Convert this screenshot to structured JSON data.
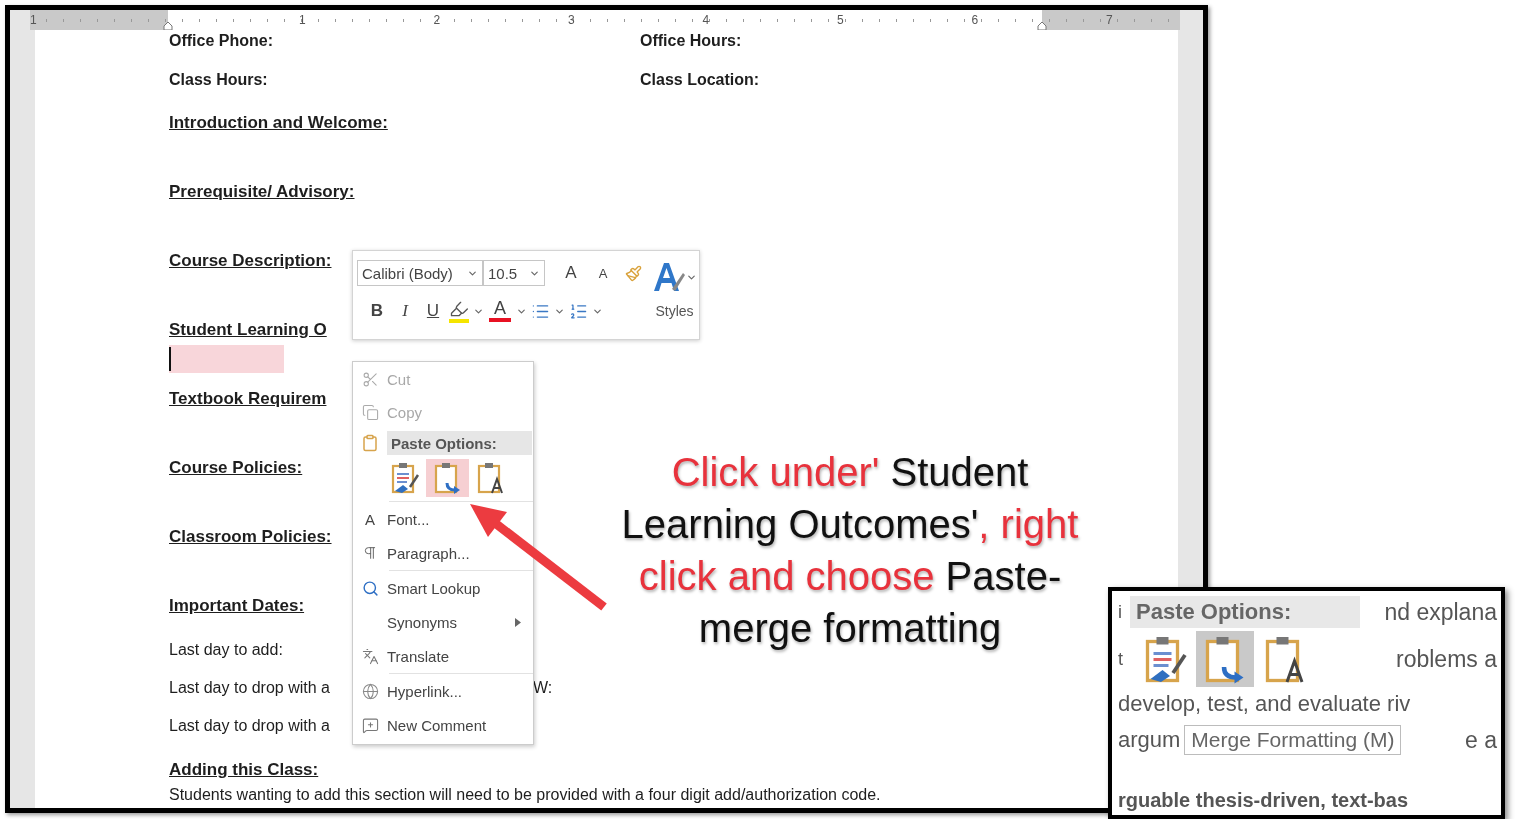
{
  "ruler": {
    "numbers": [
      "1",
      "1",
      "2",
      "3",
      "4",
      "5",
      "6",
      "7"
    ]
  },
  "document": {
    "lines": [
      {
        "kind": "pair",
        "left": "Office Phone:",
        "right": "Office Hours:"
      },
      {
        "kind": "pair",
        "left": "Class Hours:",
        "right": "Class Location:"
      },
      {
        "kind": "heading",
        "text": "Introduction and Welcome:"
      },
      {
        "kind": "heading",
        "text": "Prerequisite/ Advisory:"
      },
      {
        "kind": "heading",
        "text": "Course Description:"
      },
      {
        "kind": "heading",
        "text": "Student Learning O",
        "caret": true
      },
      {
        "kind": "heading",
        "text": "Textbook Requirem"
      },
      {
        "kind": "heading",
        "text": "Course Policies:"
      },
      {
        "kind": "heading",
        "text": "Classroom Policies:"
      },
      {
        "kind": "heading",
        "text": "Important Dates:"
      },
      {
        "kind": "text",
        "text": "Last day to add:"
      },
      {
        "kind": "text",
        "text": "Last day to drop with a",
        "right": "W:"
      },
      {
        "kind": "text",
        "text": "Last day to drop with a"
      },
      {
        "kind": "title",
        "text": "Adding this Class:"
      },
      {
        "kind": "text",
        "text": "Students wanting to add this section will need to be provided with a four digit add/authorization code."
      }
    ]
  },
  "mini_toolbar": {
    "font": "Calibri (Body)",
    "size": "10.5",
    "size_buttons": [
      "A",
      "A"
    ],
    "format_buttons": [
      "B",
      "I",
      "U"
    ],
    "font_color": "A",
    "styles": "Styles"
  },
  "context_menu": {
    "items": [
      {
        "kind": "command",
        "label": "Cut",
        "disabled": true,
        "submenu": false
      },
      {
        "kind": "command",
        "label": "Copy",
        "disabled": true,
        "submenu": false
      },
      {
        "kind": "header",
        "label": "Paste Options:"
      },
      {
        "kind": "paste",
        "options": [
          {
            "selected": false
          },
          {
            "selected": true
          },
          {
            "selected": false
          }
        ]
      },
      {
        "kind": "command",
        "label": "Font...",
        "glyph": "A",
        "disabled": false,
        "submenu": false
      },
      {
        "kind": "command",
        "label": "Paragraph...",
        "disabled": false,
        "submenu": false
      },
      {
        "kind": "command",
        "label": "Smart Lookup",
        "disabled": false,
        "submenu": false
      },
      {
        "kind": "command",
        "label": "Synonyms",
        "disabled": false,
        "submenu": true
      },
      {
        "kind": "command",
        "label": "Translate",
        "disabled": false,
        "submenu": false
      },
      {
        "kind": "command",
        "label": "Hyperlink...",
        "disabled": false,
        "submenu": false
      },
      {
        "kind": "command",
        "label": "New Comment",
        "disabled": false,
        "submenu": false
      }
    ]
  },
  "annotation": {
    "lines": [
      [
        {
          "text": "Click under'",
          "color": "#e8323c"
        },
        {
          "text": " Student",
          "color": "#111111"
        }
      ],
      [
        {
          "text": "Learning Outcomes'",
          "color": "#111111"
        },
        {
          "text": ", right",
          "color": "#e8323c"
        }
      ],
      [
        {
          "text": "click and choose ",
          "color": "#e8323c"
        },
        {
          "text": "Paste-",
          "color": "#111111"
        }
      ],
      [
        {
          "text": "merge formatting",
          "color": "#111111"
        }
      ]
    ]
  },
  "inset": {
    "header": "Paste Options:",
    "paste_options": [
      {
        "selected": false
      },
      {
        "selected": true
      },
      {
        "selected": false
      }
    ],
    "tooltip": "Merge Formatting (M)",
    "rows": [
      {
        "left": "i",
        "right": "nd explana"
      },
      {
        "left": "t",
        "right": "roblems a"
      },
      {
        "text": "develop, test, and evaluate riv",
        "bold": false
      },
      {
        "left": "argum",
        "right": "e a"
      },
      {
        "text": "rguable thesis-driven, text-bas",
        "bold": true
      }
    ]
  }
}
